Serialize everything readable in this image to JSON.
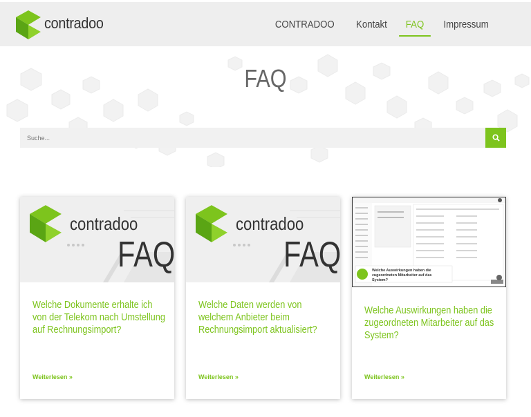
{
  "header": {
    "logo_text": "contradoo",
    "nav": [
      {
        "label": "CONTRADOO",
        "active": false
      },
      {
        "label": "Kontakt",
        "active": false
      },
      {
        "label": "FAQ",
        "active": true
      },
      {
        "label": "Impressum",
        "active": false
      }
    ]
  },
  "page": {
    "title": "FAQ",
    "search_placeholder": "Suche..."
  },
  "cards": [
    {
      "thumb_logo": "contradoo",
      "thumb_faq": "FAQ",
      "title": "Welche Dokumente erhalte ich von der Telekom nach Umstellung auf Rechnungsimport?",
      "more": "Weiterlesen »"
    },
    {
      "thumb_logo": "contradoo",
      "thumb_faq": "FAQ",
      "title": "Welche Daten werden von welchem Anbieter beim Rechnungsimport aktualisiert?",
      "more": "Weiterlesen »"
    },
    {
      "thumb_caption": "Welche Auswirkungen haben die zugeordneten Mitarbeiter auf das System?",
      "title": "Welche Auswirkungen haben die zugeordneten Mitarbeiter auf das System?",
      "more": "Weiterlesen »"
    }
  ],
  "colors": {
    "accent": "#7dc41d",
    "header_bg": "#eeeeee"
  }
}
